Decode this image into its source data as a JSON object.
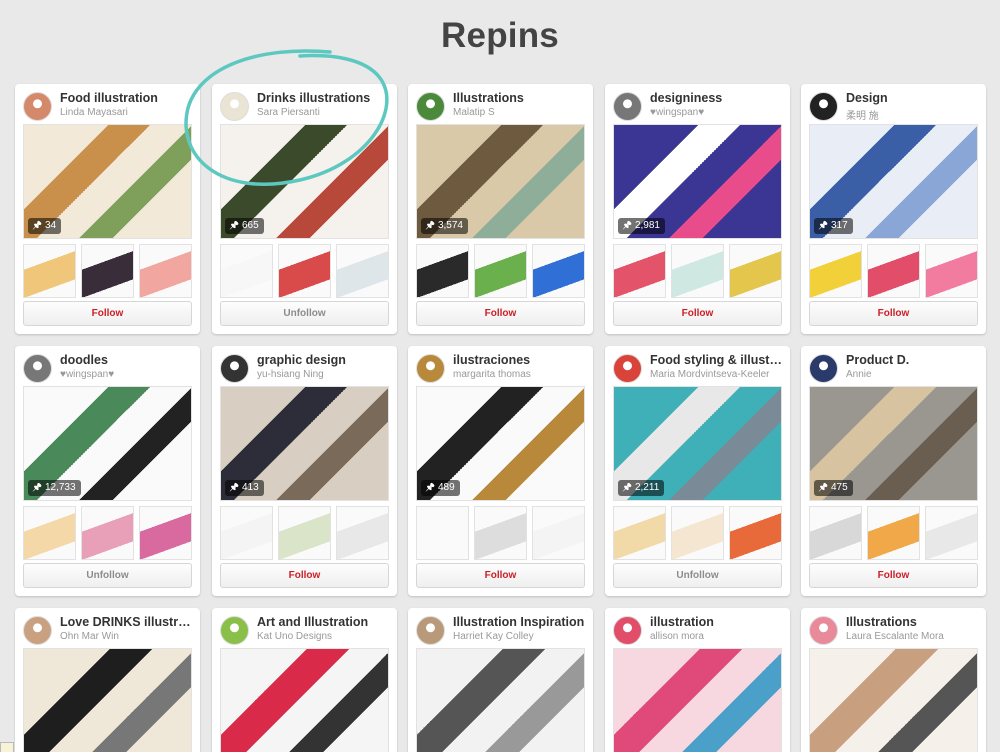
{
  "page": {
    "title": "Repins"
  },
  "colors": {
    "follow": "#cb2027",
    "unfollow": "#8c8c8c",
    "background": "#e9e9e9",
    "annotation": "#5cc8bf"
  },
  "boards": [
    {
      "title": "Food illustration",
      "owner": "Linda Mayasari",
      "pins": "34",
      "button": "Follow",
      "avatar": "#d48a6a",
      "cover": [
        "#f3e9d8",
        "#c8904a",
        "#7ea05a"
      ],
      "thumbs": [
        "#f0c77a",
        "#3a2d3a",
        "#f2a6a0"
      ]
    },
    {
      "title": "Drinks illustrations",
      "owner": "Sara Piersanti",
      "pins": "665",
      "button": "Unfollow",
      "avatar": "#e9e4d4",
      "cover": [
        "#f5f2ee",
        "#3a4a2a",
        "#b8483a"
      ],
      "thumbs": [
        "#f7f7f7",
        "#d94b4b",
        "#dfe6ea"
      ]
    },
    {
      "title": "Illustrations",
      "owner": "Malatip S",
      "pins": "3,574",
      "button": "Follow",
      "avatar": "#4a8a3a",
      "cover": [
        "#d9c9a8",
        "#6d5a3f",
        "#8fae9a"
      ],
      "thumbs": [
        "#2a2a2a",
        "#6ab04c",
        "#2f6fd6"
      ]
    },
    {
      "title": "designiness",
      "owner": "♥wingspan♥",
      "pins": "2,981",
      "button": "Follow",
      "avatar": "#777",
      "cover": [
        "#3b3593",
        "#ffffff",
        "#e84c8a"
      ],
      "thumbs": [
        "#e3536a",
        "#cfe8e2",
        "#e3c64b"
      ]
    },
    {
      "title": "Design",
      "owner": "柔明 施",
      "pins": "317",
      "button": "Follow",
      "avatar": "#222",
      "cover": [
        "#e9eef6",
        "#3b5fa6",
        "#8aa6d6"
      ],
      "thumbs": [
        "#f2d03a",
        "#e24d6a",
        "#f27ca0"
      ]
    },
    {
      "title": "doodles",
      "owner": "♥wingspan♥",
      "pins": "12,733",
      "button": "Unfollow",
      "avatar": "#777",
      "cover": [
        "#fafafa",
        "#4a8a5a",
        "#222"
      ],
      "thumbs": [
        "#f4d8a8",
        "#e8a0b8",
        "#d86aa0"
      ]
    },
    {
      "title": "graphic design",
      "owner": "yu-hsiang Ning",
      "pins": "413",
      "button": "Follow",
      "avatar": "#333",
      "cover": [
        "#d8cfc2",
        "#2d2d3a",
        "#7a6a5a"
      ],
      "thumbs": [
        "#f4f4f4",
        "#d9e4c8",
        "#e8e8e8"
      ]
    },
    {
      "title": "ilustraciones",
      "owner": "margarita thomas",
      "pins": "489",
      "button": "Follow",
      "avatar": "#b8893a",
      "cover": [
        "#fafafa",
        "#222",
        "#b8893a"
      ],
      "thumbs": [
        "#fafafa",
        "#dddddd",
        "#f4f4f4"
      ]
    },
    {
      "title": "Food styling & illustr…",
      "owner": "Maria Mordvintseva-Keeler",
      "pins": "2,211",
      "button": "Unfollow",
      "avatar": "#d9433a",
      "cover": [
        "#3fb0b8",
        "#e8e8e8",
        "#7a8a96"
      ],
      "thumbs": [
        "#f1d9a8",
        "#f4e6d0",
        "#e86a3a"
      ]
    },
    {
      "title": "Product D.",
      "owner": "Annie",
      "pins": "475",
      "button": "Follow",
      "avatar": "#2a3a6a",
      "cover": [
        "#9a9690",
        "#d8c3a0",
        "#6a5e50"
      ],
      "thumbs": [
        "#d8d8d8",
        "#f0a848",
        "#e8e8e8"
      ]
    },
    {
      "title": "Love DRINKS illustra…",
      "owner": "Ohn Mar Win",
      "pins": "",
      "button": "",
      "avatar": "#c9a080",
      "cover": [
        "#efe8d8",
        "#1e1e1e",
        "#777"
      ],
      "thumbs": []
    },
    {
      "title": "Art and Illustration",
      "owner": "Kat Uno Designs",
      "pins": "",
      "button": "",
      "avatar": "#8ac04a",
      "cover": [
        "#f5f5f5",
        "#d92a4a",
        "#333"
      ],
      "thumbs": []
    },
    {
      "title": "Illustration Inspiration",
      "owner": "Harriet Kay Colley",
      "pins": "",
      "button": "",
      "avatar": "#b89a7a",
      "cover": [
        "#f2f2f2",
        "#555",
        "#999"
      ],
      "thumbs": []
    },
    {
      "title": "illustration",
      "owner": "allison mora",
      "pins": "",
      "button": "",
      "avatar": "#e24d6a",
      "cover": [
        "#f8d8e0",
        "#e04a7a",
        "#4aa0c8"
      ],
      "thumbs": []
    },
    {
      "title": "Illustrations",
      "owner": "Laura Escalante Mora",
      "pins": "",
      "button": "",
      "avatar": "#e88a9a",
      "cover": [
        "#f6f0ea",
        "#c8a080",
        "#555"
      ],
      "thumbs": []
    }
  ]
}
